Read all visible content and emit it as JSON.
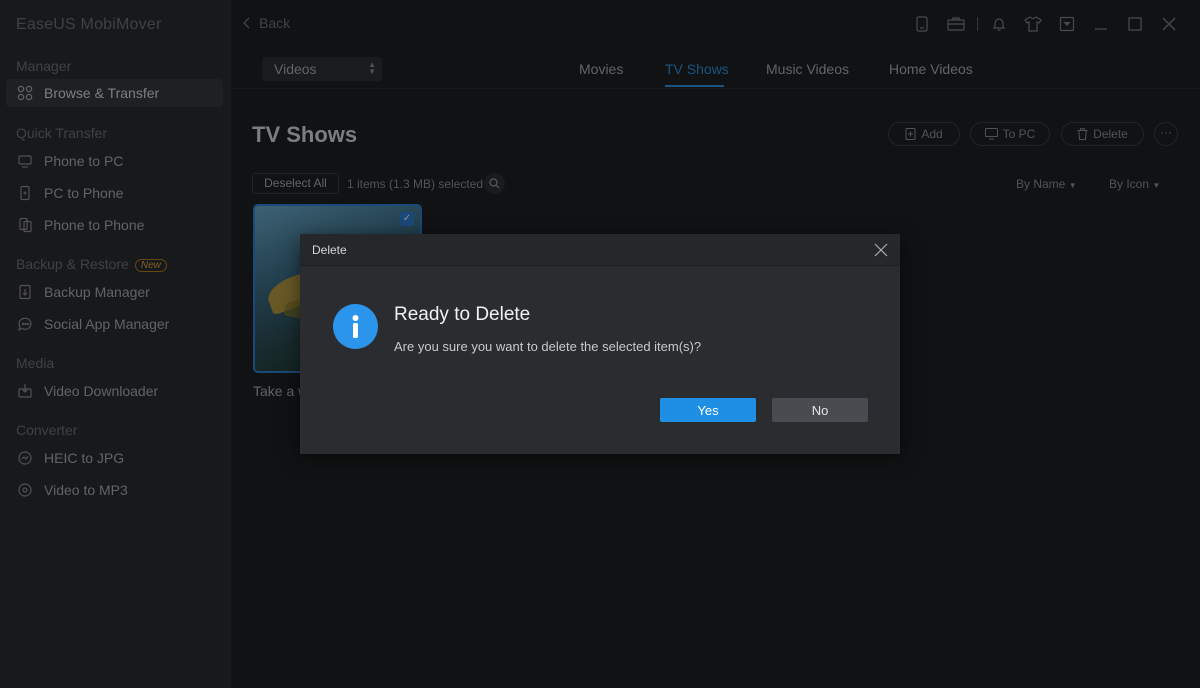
{
  "app": {
    "title": "EaseUS MobiMover"
  },
  "sidebar": {
    "sections": {
      "manager": "Manager",
      "quick_transfer": "Quick Transfer",
      "backup_restore": "Backup & Restore",
      "backup_badge": "New",
      "media": "Media",
      "converter": "Converter"
    },
    "items": [
      {
        "label": "Browse & Transfer",
        "icon": "browse-grid-icon",
        "active": true
      },
      {
        "label": "Phone to PC",
        "icon": "phone-to-pc-icon"
      },
      {
        "label": "PC to Phone",
        "icon": "pc-to-phone-icon"
      },
      {
        "label": "Phone to Phone",
        "icon": "phone-to-phone-icon"
      },
      {
        "label": "Backup Manager",
        "icon": "backup-icon"
      },
      {
        "label": "Social App Manager",
        "icon": "chat-icon"
      },
      {
        "label": "Video Downloader",
        "icon": "download-icon"
      },
      {
        "label": "HEIC to JPG",
        "icon": "convert-image-icon"
      },
      {
        "label": "Video to MP3",
        "icon": "convert-audio-icon"
      }
    ]
  },
  "topbar": {
    "back_label": "Back"
  },
  "category": {
    "selected": "Videos"
  },
  "tabs": [
    {
      "label": "Movies",
      "active": false
    },
    {
      "label": "TV Shows",
      "active": true
    },
    {
      "label": "Music Videos",
      "active": false
    },
    {
      "label": "Home Videos",
      "active": false
    }
  ],
  "content": {
    "title": "TV Shows",
    "actions": {
      "add": "Add",
      "to_pc": "To PC",
      "delete": "Delete",
      "more": "···"
    },
    "deselect_label": "Deselect All",
    "selection_info": "1 items (1.3 MB) selected",
    "sort_name": "By Name",
    "sort_icon": "By Icon",
    "items": [
      {
        "caption": "Take a w",
        "selected": true
      }
    ]
  },
  "dialog": {
    "title": "Delete",
    "heading": "Ready to Delete",
    "message": "Are you sure you want to delete the selected item(s)?",
    "yes_label": "Yes",
    "no_label": "No"
  },
  "colors": {
    "accent": "#2f8fe0",
    "info": "#2a95ea",
    "sidebar_bg": "#2a2b2f",
    "main_bg": "#1e1f22"
  }
}
